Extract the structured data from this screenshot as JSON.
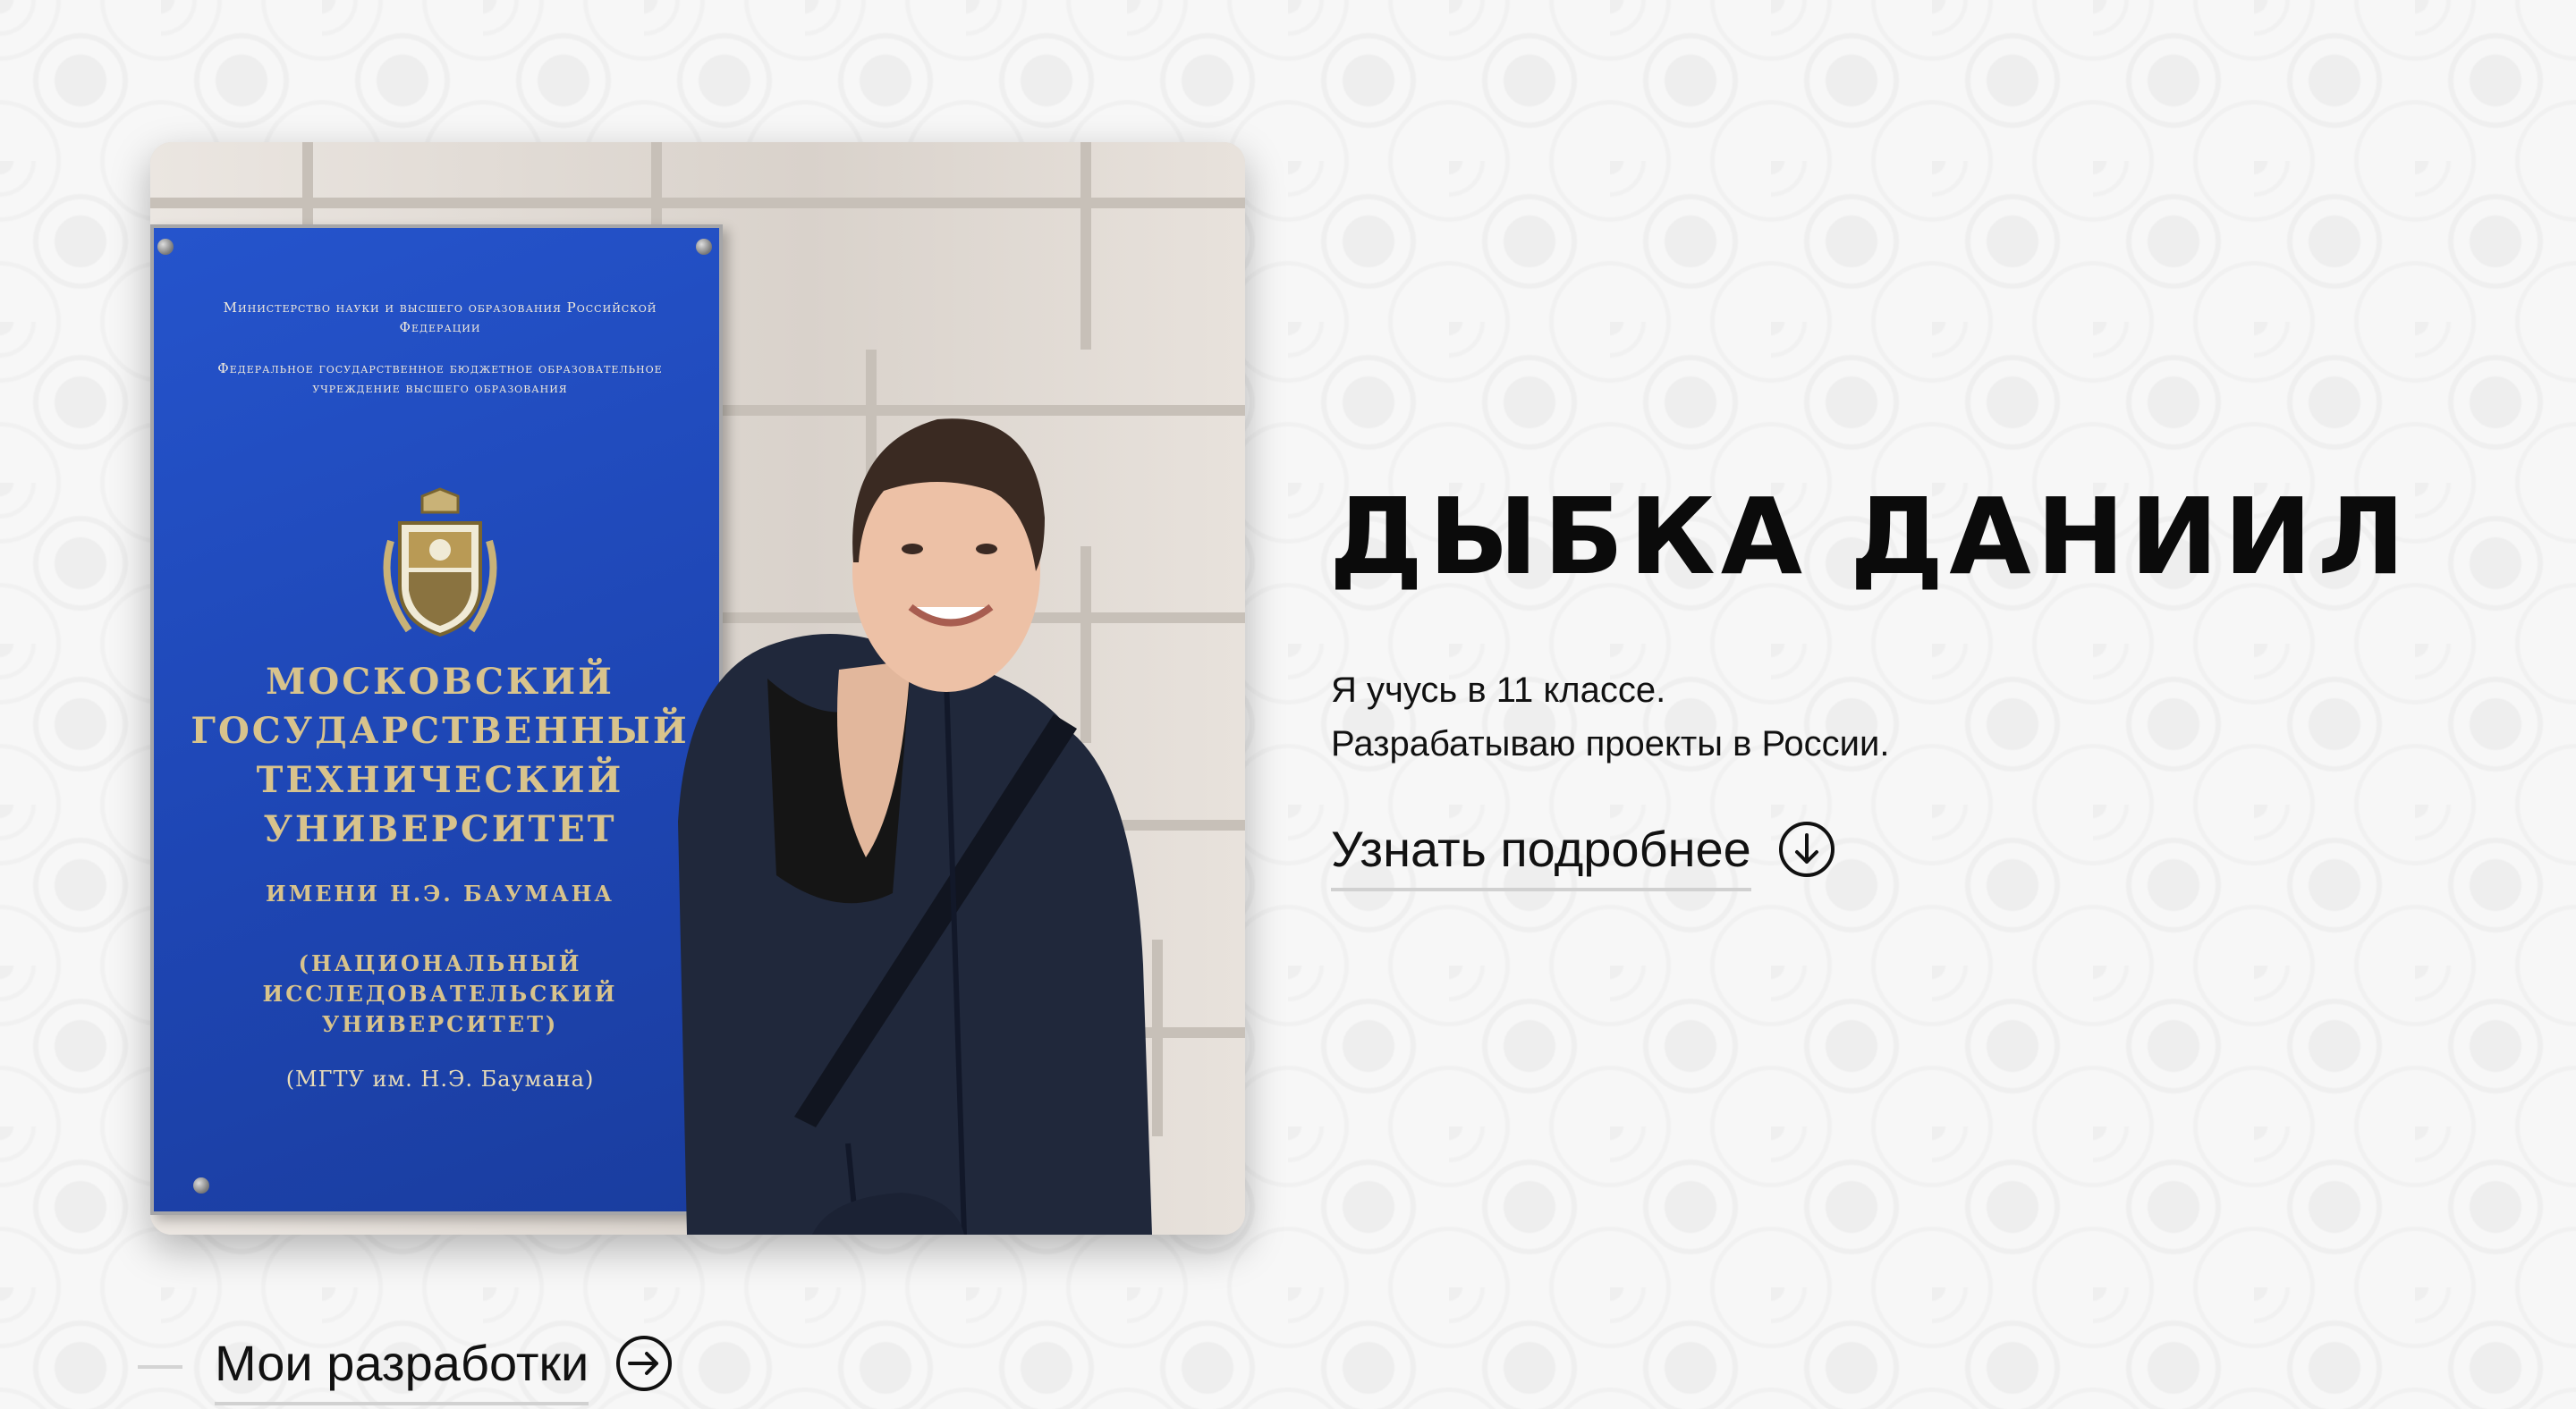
{
  "hero": {
    "name": "ДЫБКА ДАНИИЛ",
    "line1": "Я учусь в 11 классе.",
    "line2": "Разрабатываю проекты в России.",
    "learn_more": "Узнать подробнее",
    "learn_more_icon": "arrow-down-circle-icon"
  },
  "photo": {
    "plaque": {
      "ministry": "Министерство науки и высшего образования Российской Федерации",
      "institution": "Федеральное государственное бюджетное образовательное учреждение высшего образования",
      "title_lines": [
        "МОСКОВСКИЙ",
        "ГОСУДАРСТВЕННЫЙ",
        "ТЕХНИЧЕСКИЙ",
        "УНИВЕРСИТЕТ"
      ],
      "named": "ИМЕНИ Н.Э. БАУМАНА",
      "status_lines": [
        "(НАЦИОНАЛЬНЫЙ",
        "ИССЛЕДОВАТЕЛЬСКИЙ",
        "УНИВЕРСИТЕТ)"
      ],
      "abbr": "(МГТУ им. Н.Э. Баумана)"
    }
  },
  "footer_link": {
    "label": "Мои разработки",
    "icon": "arrow-right-circle-icon"
  },
  "colors": {
    "text": "#111111",
    "plaque_blue": "#2050c0",
    "plaque_gold": "#d8c38c",
    "underline": "#d1d1d1"
  }
}
